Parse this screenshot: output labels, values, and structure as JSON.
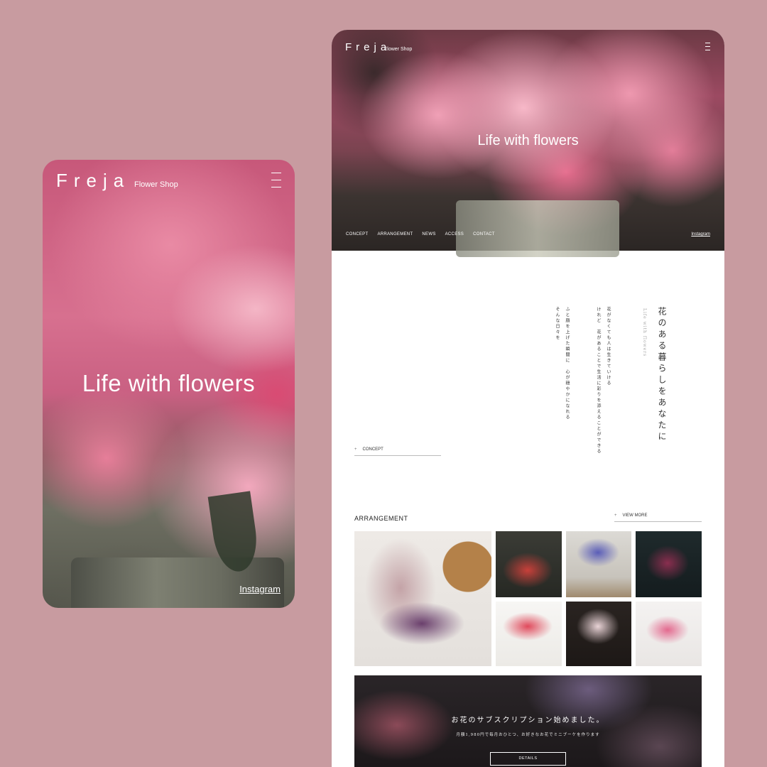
{
  "brand": {
    "logo": "Freja",
    "subtitle": "Flower Shop"
  },
  "hero": {
    "title": "Life with flowers",
    "instagram": "Instagram"
  },
  "nav": [
    "CONCEPT",
    "ARRANGEMENT",
    "NEWS",
    "ACCESS",
    "CONTACT"
  ],
  "concept": {
    "heading_ja": "花のある暮らしをあなたに",
    "heading_en": "Life with flowers",
    "body_lines": [
      "花がなくても人は生きていける",
      "けれど　花があることで生活に彩りを添えることができる",
      "ふと顔を上げた瞬間に　心が穏やかになれる",
      "そんな日々を"
    ],
    "link_label": "CONCEPT"
  },
  "arrangement": {
    "title": "ARRANGEMENT",
    "view_more": "VIEW MORE"
  },
  "subscription": {
    "title": "お花のサブスクリプション始めました。",
    "text": "月額1,980円で毎月おひとつ、お好きなお花でミニブーケを作ります",
    "button": "DETAILS"
  },
  "icons": {
    "menu": "hamburger-menu-icon",
    "plus": "plus-icon"
  },
  "colors": {
    "background": "#c89ba0",
    "accent": "#e98aa4"
  }
}
